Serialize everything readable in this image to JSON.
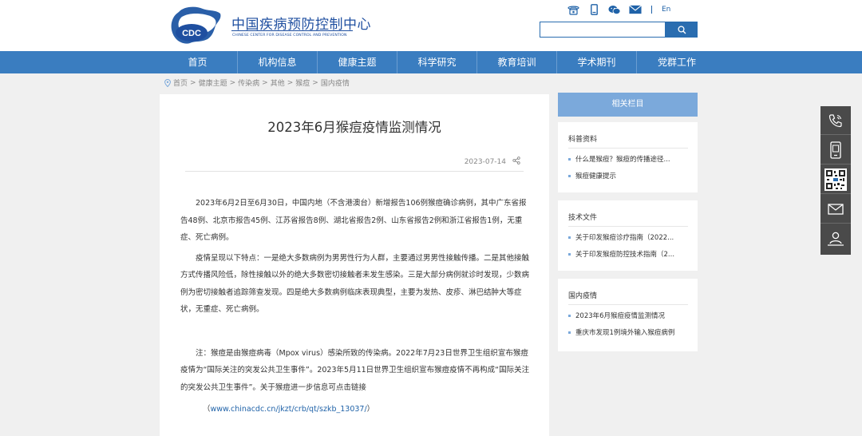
{
  "header": {
    "org_cn": "中国疾病预防控制中心",
    "org_en": "CHINESE CENTER FOR DISEASE CONTROL AND PREVENTION",
    "logo_text": "CDC",
    "lang_label": "En",
    "search_placeholder": "",
    "icons": [
      "phone-icon",
      "mobile-icon",
      "wechat-icon",
      "mail-icon",
      "search-icon"
    ],
    "brand_color": "#1f4fa0"
  },
  "nav": {
    "items": [
      {
        "label": "首页"
      },
      {
        "label": "机构信息"
      },
      {
        "label": "健康主题"
      },
      {
        "label": "科学研究"
      },
      {
        "label": "教育培训"
      },
      {
        "label": "学术期刊"
      },
      {
        "label": "党群工作"
      }
    ],
    "bar_color": "#3a7dc0"
  },
  "breadcrumb": {
    "items": [
      "首页",
      "健康主题",
      "传染病",
      "其他",
      "猴痘",
      "国内疫情"
    ],
    "separator": ">"
  },
  "article": {
    "title": "2023年6月猴痘疫情监测情况",
    "date": "2023-07-14",
    "paragraphs": [
      "2023年6月2日至6月30日，中国内地（不含港澳台）新增报告106例猴痘确诊病例，其中广东省报告48例、北京市报告45例、江苏省报告8例、湖北省报告2例、山东省报告2例和浙江省报告1例，无重症、死亡病例。",
      "疫情呈现以下特点：一是绝大多数病例为男男性行为人群，主要通过男男性接触传播。二是其他接触方式传播风险低，除性接触以外的绝大多数密切接触者未发生感染。三是大部分病例就诊时发现，少数病例为密切接触者追踪筛查发现。四是绝大多数病例临床表现典型，主要为发热、皮疹、淋巴结肿大等症状，无重症、死亡病例。",
      "注：猴痘是由猴痘病毒（Mpox virus）感染所致的传染病。2022年7月23日世界卫生组织宣布猴痘疫情为“国际关注的突发公共卫生事件”。2023年5月11日世界卫生组织宣布猴痘疫情不再构成“国际关注的突发公共卫生事件”。关于猴痘进一步信息可点击链接"
    ],
    "link_open": "（",
    "link_text": "www.chinacdc.cn/jkzt/crb/qt/szkb_13037/",
    "link_close": "）"
  },
  "sidebar": {
    "header": "相关栏目",
    "sections": [
      {
        "title": "科普资料",
        "items": [
          "什么是猴痘？猴痘的传播途径...",
          "猴痘健康提示"
        ]
      },
      {
        "title": "技术文件",
        "items": [
          "关于印发猴痘诊疗指南（2022...",
          "关于印发猴痘防控技术指南（2..."
        ]
      },
      {
        "title": "国内疫情",
        "items": [
          "2023年6月猴痘疫情监测情况",
          "重庆市发现1例境外输入猴痘病例"
        ]
      }
    ],
    "accent_color": "#7ba9db"
  },
  "float_bar": {
    "icons": [
      "phone-call-icon",
      "mobile-app-icon",
      "qrcode-icon",
      "mail-icon",
      "user-location-icon"
    ]
  }
}
